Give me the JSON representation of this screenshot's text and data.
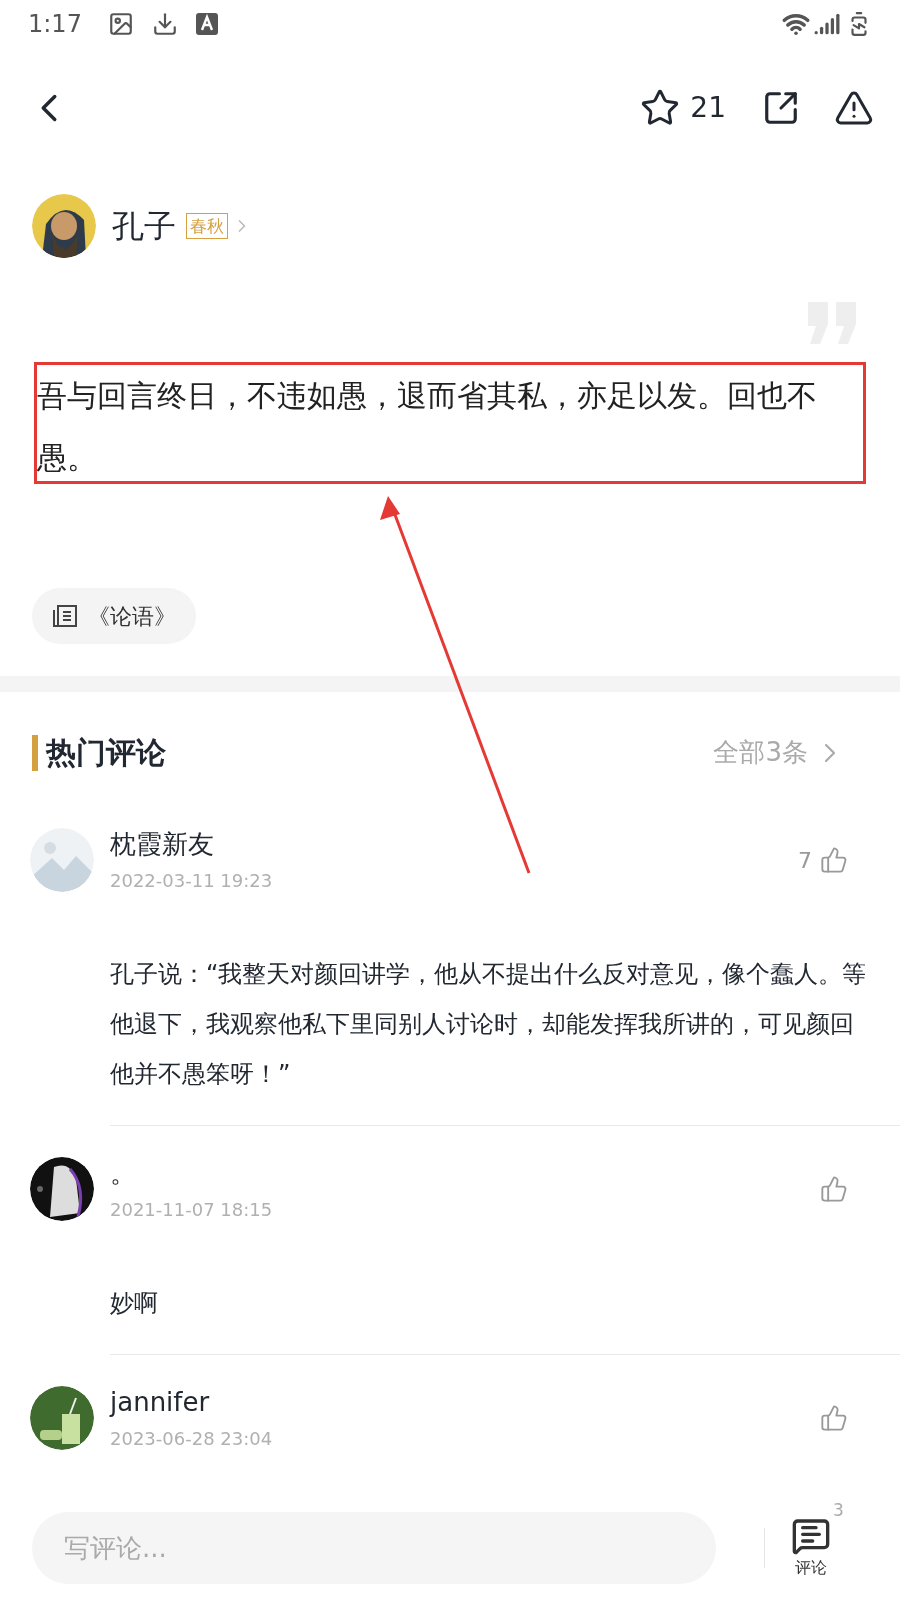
{
  "status_bar": {
    "time": "1:17"
  },
  "toolbar": {
    "favorites_count": "21"
  },
  "author": {
    "name": "孔子",
    "era": "春秋"
  },
  "quote": {
    "text": "吾与回言终日，不违如愚，退而省其私，亦足以发。回也不愚。"
  },
  "source": {
    "title": "《论语》"
  },
  "comments_section": {
    "title": "热门评论",
    "all_link": "全部3条"
  },
  "comments": [
    {
      "user": "枕霞新友",
      "date": "2022-03-11 19:23",
      "likes": "7",
      "text": "孔子说：“我整天对颜回讲学，他从不提出什么反对意见，像个蠢人。等他退下，我观察他私下里同别人讨论时，却能发挥我所讲的，可见颜回他并不愚笨呀！”"
    },
    {
      "user": "。",
      "date": "2021-11-07 18:15",
      "text": "妙啊"
    },
    {
      "user": "jannifer",
      "date": "2023-06-28 23:04"
    }
  ],
  "comment_input": {
    "placeholder": "写评论..."
  },
  "comment_button": {
    "label": "评论",
    "count": "3"
  }
}
